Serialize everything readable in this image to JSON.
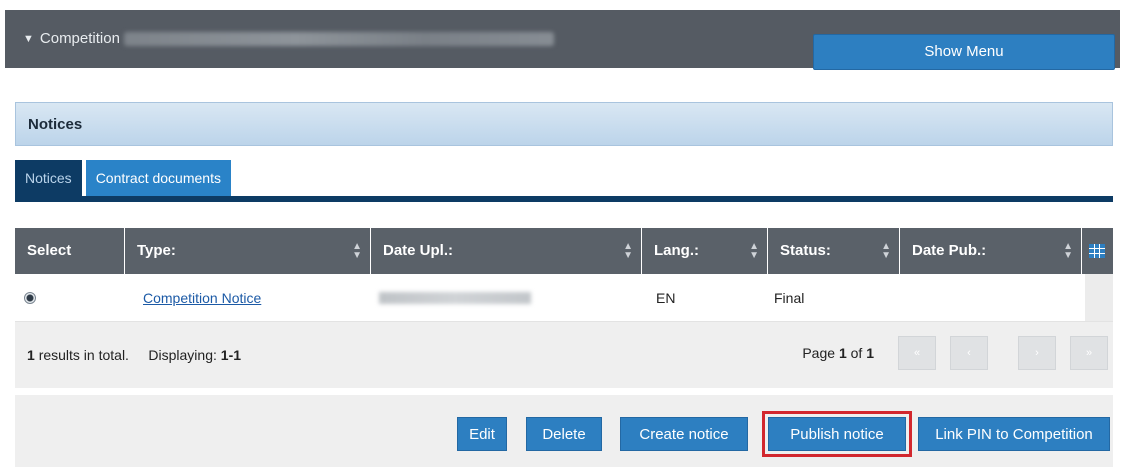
{
  "header": {
    "crumb_label": "Competition",
    "show_menu_label": "Show Menu"
  },
  "notices_title": "Notices",
  "tabs": [
    {
      "label": "Notices",
      "active": true
    },
    {
      "label": "Contract documents",
      "active": false
    }
  ],
  "grid": {
    "columns": [
      "Select",
      "Type:",
      "Date Upl.:",
      "Lang.:",
      "Status:",
      "Date Pub.:"
    ],
    "rows": [
      {
        "type": "Competition Notice",
        "lang": "EN",
        "status": "Final",
        "date_pub": ""
      }
    ],
    "results_count": "1",
    "results_suffix": "results in total.",
    "displaying_label": "Displaying:",
    "displaying_range": "1-1",
    "page_label": "Page",
    "page_current": "1",
    "page_of": "of",
    "page_total": "1"
  },
  "actions": {
    "edit": "Edit",
    "delete": "Delete",
    "create_notice": "Create notice",
    "publish_notice": "Publish notice",
    "link_pin": "Link PIN to Competition"
  },
  "colors": {
    "header_bg": "#555b63",
    "accent_blue": "#2d7fc1",
    "tab_active": "#0d3b64",
    "highlight_red": "#d2272e"
  }
}
